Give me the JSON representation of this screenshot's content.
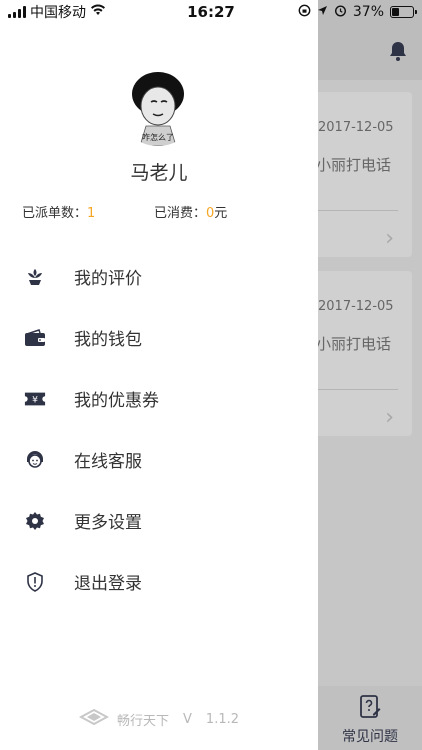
{
  "status_bar": {
    "carrier": "中国移动",
    "time": "16:27",
    "battery": "37%",
    "battery_level": 0.37
  },
  "background": {
    "cards": [
      {
        "date": "2017-12-05",
        "text": "小丽打电话"
      },
      {
        "date": "2017-12-05",
        "text": "小丽打电话"
      }
    ],
    "bottom_tab": {
      "label": "常见问题",
      "icon": "question-doc-icon"
    }
  },
  "drawer": {
    "avatar_caption": "咋怎么了",
    "user_name": "马老儿",
    "stats": {
      "dispatched_label": "已派单数：",
      "dispatched_value": "1",
      "spent_label": "已消费：",
      "spent_value": "0",
      "spent_unit": "元"
    },
    "menu": [
      {
        "label": "我的评价",
        "icon": "flower-icon"
      },
      {
        "label": "我的钱包",
        "icon": "wallet-icon"
      },
      {
        "label": "我的优惠券",
        "icon": "coupon-icon"
      },
      {
        "label": "在线客服",
        "icon": "customer-service-icon"
      },
      {
        "label": "更多设置",
        "icon": "gear-icon"
      },
      {
        "label": "退出登录",
        "icon": "shield-exclamation-icon"
      }
    ],
    "footer": {
      "brand": "畅行天下",
      "version_prefix": "V",
      "version": "1.1.2"
    }
  },
  "colors": {
    "accent": "#f5a623",
    "icon_dark": "#2f3346",
    "overlay": "#c6c6c6"
  }
}
